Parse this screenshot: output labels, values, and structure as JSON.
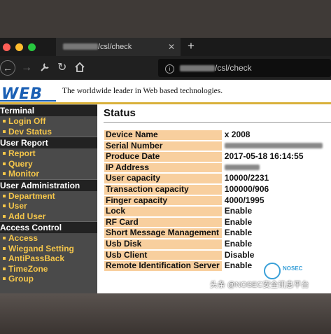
{
  "browser": {
    "tab_title": "/csl/check",
    "tab_close": "✕",
    "new_tab": "+",
    "url": "/csl/check"
  },
  "header": {
    "logo": "WEB",
    "tagline": "The worldwide leader in Web based technologies."
  },
  "sidebar": {
    "sections": [
      {
        "title": "Terminal",
        "items": [
          "Login Off",
          "Dev Status"
        ]
      },
      {
        "title": "User Report",
        "items": [
          "Report",
          "Query",
          "Monitor"
        ]
      },
      {
        "title": "User Administration",
        "items": [
          "Department",
          "User",
          "Add User"
        ]
      },
      {
        "title": "Access Control",
        "items": [
          "Access",
          "Wiegand Setting",
          "AntiPassBack",
          "TimeZone",
          "Group"
        ]
      }
    ]
  },
  "main": {
    "title": "Status",
    "rows": [
      {
        "key": "Device Name",
        "value": "x 2008"
      },
      {
        "key": "Serial Number",
        "value": ""
      },
      {
        "key": "Produce Date",
        "value": "2017-05-18 16:14:55"
      },
      {
        "key": "IP Address",
        "value": ""
      },
      {
        "key": "User capacity",
        "value": "10000/2231"
      },
      {
        "key": "Transaction capacity",
        "value": "100000/906"
      },
      {
        "key": "Finger capacity",
        "value": "4000/1995"
      },
      {
        "key": "Lock",
        "value": "Enable"
      },
      {
        "key": "RF Card",
        "value": "Enable"
      },
      {
        "key": "Short Message Management",
        "value": "Enable"
      },
      {
        "key": "Usb Disk",
        "value": "Enable"
      },
      {
        "key": "Usb Client",
        "value": "Disable"
      },
      {
        "key": "Remote Identification Server",
        "value": "Enable"
      }
    ]
  },
  "overlay": {
    "watermark": "头条 @NOSEC安全讯息平台",
    "nosec_label": "NOSEC"
  },
  "colors": {
    "sidebar_link": "#f5c64a",
    "table_key_bg": "#f8cf9e",
    "logo_blue": "#1a5fb4",
    "gold_rule": "#d9b13b"
  }
}
